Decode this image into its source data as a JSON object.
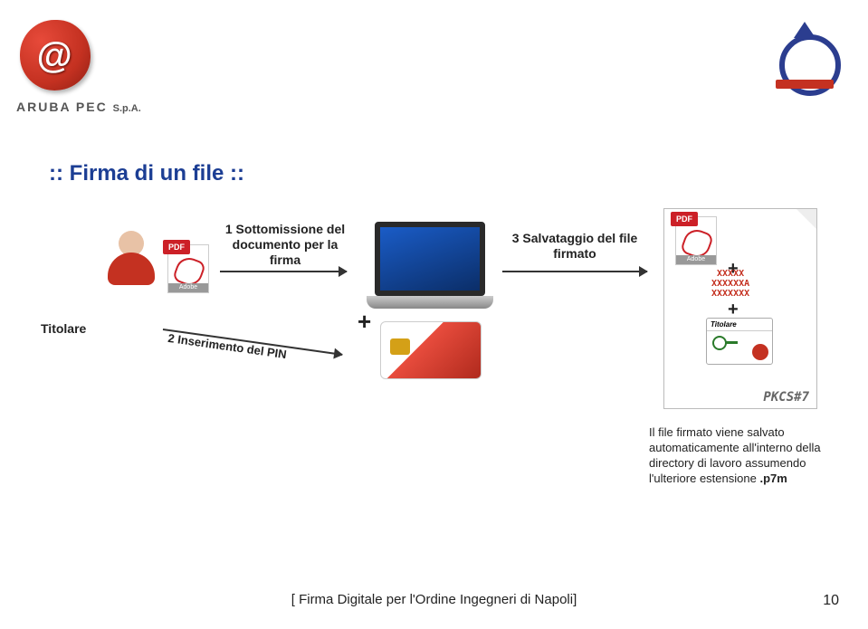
{
  "header": {
    "brand": "ARUBA PEC",
    "brand_suffix": "S.p.A."
  },
  "slide": {
    "title": ":: Firma di un file ::"
  },
  "diagram": {
    "titolare": "Titolare",
    "step1": "1 Sottomissione del documento per la firma",
    "step2": "2 Inserimento del PIN",
    "plus": "+",
    "step3": "3 Salvataggio del file firmato",
    "pdf_label": "PDF",
    "adobe_label": "Adobe",
    "pkcs": {
      "plus": "+",
      "xxxx": "XXXXX\nXXXXXXA\nXXXXXXX",
      "cert_title": "Titolare",
      "label": "PKCS#7"
    },
    "description": "Il file firmato viene salvato automaticamente all'interno della directory di lavoro assumendo l'ulteriore estensione",
    "description_ext": ".p7m"
  },
  "footer": {
    "text": "[ Firma Digitale per l'Ordine Ingegneri di Napoli]",
    "page": "10"
  }
}
